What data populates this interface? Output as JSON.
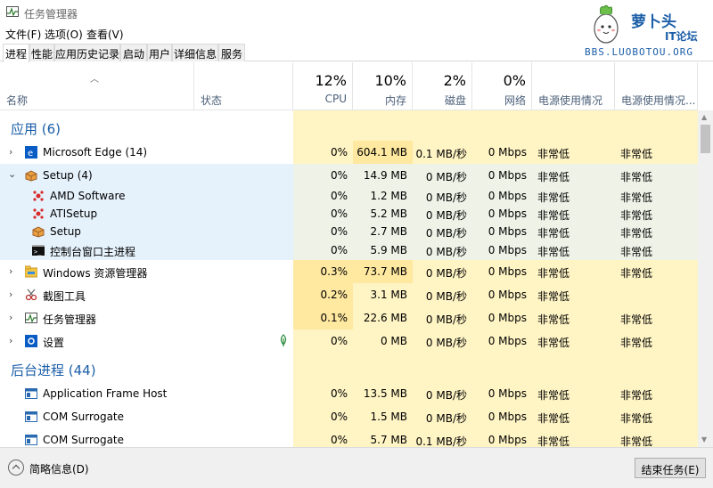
{
  "window": {
    "title": "任务管理器"
  },
  "watermark": {
    "name": "萝卜头",
    "it": "IT论坛",
    "url": "BBS.LUOBOTOU.ORG"
  },
  "menu": [
    "文件(F)",
    "选项(O)",
    "查看(V)"
  ],
  "tabs": [
    "进程",
    "性能",
    "应用历史记录",
    "启动",
    "用户",
    "详细信息",
    "服务"
  ],
  "active_tab": "进程",
  "columns": {
    "name": "名称",
    "status": "状态",
    "cpu": {
      "pct": "12%",
      "label": "CPU"
    },
    "memory": {
      "pct": "10%",
      "label": "内存"
    },
    "disk": {
      "pct": "2%",
      "label": "磁盘"
    },
    "network": {
      "pct": "0%",
      "label": "网络"
    },
    "power": "电源使用情况",
    "power_trend": "电源使用情况..."
  },
  "groups": {
    "apps": "应用 (6)",
    "background": "后台进程 (44)"
  },
  "rows": [
    {
      "name": "Microsoft Edge (14)",
      "icon": "edge-icon",
      "cpu": "0%",
      "mem": "604.1 MB",
      "disk": "0.1 MB/秒",
      "net": "0 Mbps",
      "power": "非常低",
      "trend": "非常低"
    },
    {
      "name": "Setup (4)",
      "icon": "setup-icon",
      "cpu": "0%",
      "mem": "14.9 MB",
      "disk": "0 MB/秒",
      "net": "0 Mbps",
      "power": "非常低",
      "trend": "非常低"
    },
    {
      "name": "AMD Software",
      "icon": "amd-icon",
      "cpu": "0%",
      "mem": "1.2 MB",
      "disk": "0 MB/秒",
      "net": "0 Mbps",
      "power": "非常低",
      "trend": "非常低"
    },
    {
      "name": "ATISetup",
      "icon": "amd-icon",
      "cpu": "0%",
      "mem": "5.2 MB",
      "disk": "0 MB/秒",
      "net": "0 Mbps",
      "power": "非常低",
      "trend": "非常低"
    },
    {
      "name": "Setup",
      "icon": "setup-icon",
      "cpu": "0%",
      "mem": "2.7 MB",
      "disk": "0 MB/秒",
      "net": "0 Mbps",
      "power": "非常低",
      "trend": "非常低"
    },
    {
      "name": "控制台窗口主进程",
      "icon": "console-icon",
      "cpu": "0%",
      "mem": "5.9 MB",
      "disk": "0 MB/秒",
      "net": "0 Mbps",
      "power": "非常低",
      "trend": "非常低"
    },
    {
      "name": "Windows 资源管理器",
      "icon": "explorer-icon",
      "cpu": "0.3%",
      "mem": "73.7 MB",
      "disk": "0 MB/秒",
      "net": "0 Mbps",
      "power": "非常低",
      "trend": "非常低"
    },
    {
      "name": "截图工具",
      "icon": "snipping-icon",
      "cpu": "0.2%",
      "mem": "3.1 MB",
      "disk": "0 MB/秒",
      "net": "0 Mbps",
      "power": "非常低",
      "trend": ""
    },
    {
      "name": "任务管理器",
      "icon": "taskmgr-icon",
      "cpu": "0.1%",
      "mem": "22.6 MB",
      "disk": "0 MB/秒",
      "net": "0 Mbps",
      "power": "非常低",
      "trend": "非常低"
    },
    {
      "name": "设置",
      "icon": "settings-icon",
      "cpu": "0%",
      "mem": "0 MB",
      "disk": "0 MB/秒",
      "net": "0 Mbps",
      "power": "非常低",
      "trend": "非常低"
    },
    {
      "name": "Application Frame Host",
      "icon": "window-icon",
      "cpu": "0%",
      "mem": "13.5 MB",
      "disk": "0 MB/秒",
      "net": "0 Mbps",
      "power": "非常低",
      "trend": "非常低"
    },
    {
      "name": "COM Surrogate",
      "icon": "window-icon",
      "cpu": "0%",
      "mem": "1.5 MB",
      "disk": "0 MB/秒",
      "net": "0 Mbps",
      "power": "非常低",
      "trend": "非常低"
    },
    {
      "name": "COM Surrogate",
      "icon": "window-icon",
      "cpu": "0%",
      "mem": "5.7 MB",
      "disk": "0.1 MB/秒",
      "net": "0 Mbps",
      "power": "非常低",
      "trend": "非常低"
    }
  ],
  "footer": {
    "fewer_details": "简略信息(D)",
    "end_task": "结束任务(E)"
  },
  "colors": {
    "accent": "#1b5ea8",
    "heat_light": "#fff4c4",
    "heat_mid": "#ffe8a0",
    "selected": "#e5f1fb"
  }
}
